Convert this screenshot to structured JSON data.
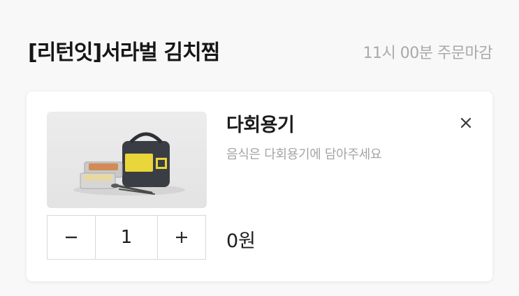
{
  "header": {
    "store_name": "[리턴잇]서라벌 김치찜",
    "order_deadline": "11시 00분 주문마감"
  },
  "cart_item": {
    "title": "다회용기",
    "description": "음식은 다회용기에 담아주세요",
    "remove_icon": "close-icon",
    "quantity": "1",
    "decrement_icon": "minus-icon",
    "increment_icon": "plus-icon",
    "price": "0원",
    "image_alt_icon": "reusable-container-set-image"
  },
  "colors": {
    "title_text": "#161616",
    "muted_text": "#a9a9a9",
    "border": "#d8d8d8",
    "card_bg": "#ffffff",
    "page_bg": "#f8f8f8"
  }
}
